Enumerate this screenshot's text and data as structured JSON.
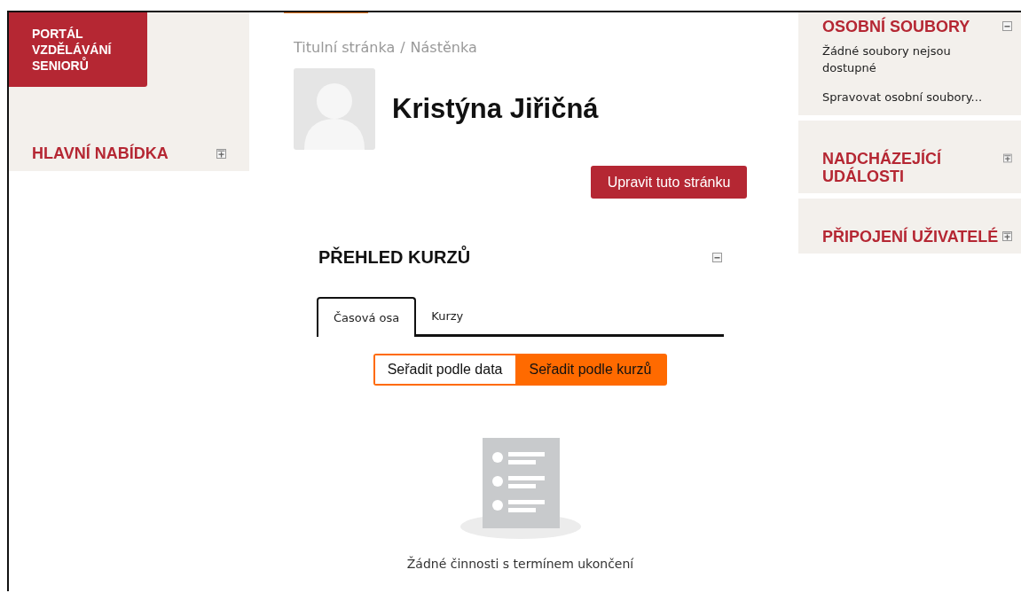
{
  "logo": {
    "text": "PORTÁL VZDĚLÁVÁNÍ SENIORŮ"
  },
  "left_blocks": [
    {
      "title": "HLAVNÍ NABÍDKA",
      "expanded": false
    }
  ],
  "breadcrumb": [
    {
      "label": "Titulní stránka"
    },
    {
      "label": "Nástěnka"
    }
  ],
  "breadcrumb_separator": "/",
  "user": {
    "name": "Kristýna Jiřičná"
  },
  "edit_button": "Upravit tuto stránku",
  "course_overview": {
    "title": "PŘEHLED KURZŮ",
    "expanded": true,
    "tabs": [
      {
        "label": "Časová osa",
        "selected": true
      },
      {
        "label": "Kurzy",
        "selected": false
      }
    ],
    "sort_buttons": [
      {
        "label": "Seřadit podle data",
        "selected": false
      },
      {
        "label": "Seřadit podle kurzů",
        "selected": true
      }
    ],
    "empty_message": "Žádné činnosti s termínem ukončení"
  },
  "right_blocks": [
    {
      "title": "OSOBNÍ SOUBORY",
      "expanded": true,
      "lines": [
        "Žádné soubory nejsou dostupné"
      ],
      "link": "Spravovat osobní soubory..."
    },
    {
      "title": "NADCHÁZEJÍCÍ UDÁLOSTI",
      "expanded": false
    },
    {
      "title": "PŘIPOJENÍ UŽIVATELÉ",
      "expanded": false
    }
  ]
}
